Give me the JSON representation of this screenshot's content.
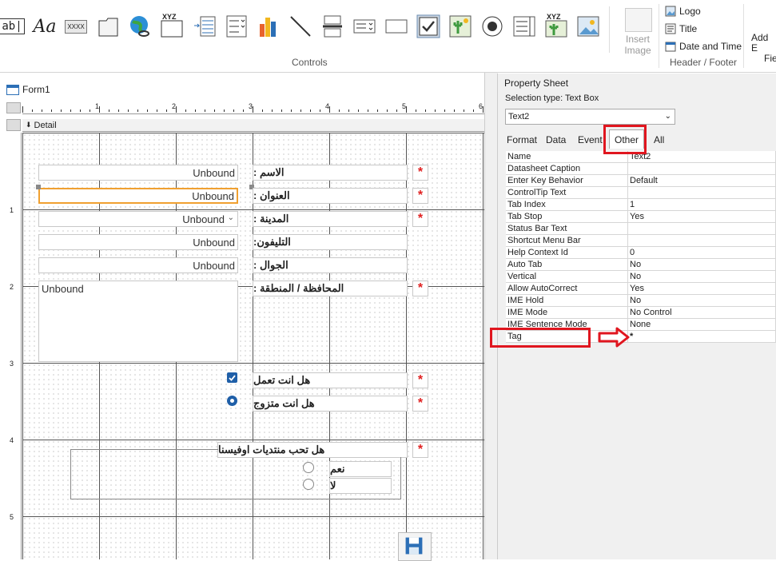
{
  "ribbon": {
    "controls_label": "Controls",
    "header_footer_label": "Header / Footer",
    "insert_image_label_1": "Insert",
    "insert_image_label_2": "Image",
    "textbox_icon_text": "ab|",
    "label_icon_text": "Aa",
    "button_icon_text": "XXXX",
    "xyz": "XYZ",
    "hf_items": [
      "Logo",
      "Title",
      "Date and Time"
    ],
    "add_fields_1": "Add E",
    "add_fields_2": "Fie"
  },
  "form": {
    "tab_title": "Form1",
    "section_title": "Detail",
    "ruler_numbers": [
      "1",
      "2",
      "3",
      "4",
      "5",
      "6"
    ],
    "vruler_numbers": [
      "1",
      "2",
      "3",
      "4",
      "5"
    ],
    "unbound": [
      "Unbound",
      "Unbound",
      "Unbound",
      "Unbound",
      "Unbound",
      "Unbound"
    ],
    "labels": {
      "name": "الاسم :",
      "address": "العنوان :",
      "city": "المدينة :",
      "phone": "التليفون:",
      "mobile": "الجوال :",
      "region": "المحافظة / المنطقة :",
      "work": "هل انت تعمل",
      "married": "هل انت متزوج",
      "forums": "هل تحب منتديات اوفيسنا",
      "yes": "نعم",
      "no": "لا"
    },
    "star": "*"
  },
  "property_sheet": {
    "title": "Property Sheet",
    "selection_type": "Selection type:  Text Box",
    "selected_control": "Text2",
    "tabs": [
      "Format",
      "Data",
      "Event",
      "Other",
      "All"
    ],
    "active_tab": "Other",
    "rows": [
      {
        "key": "Name",
        "value": "Text2"
      },
      {
        "key": "Datasheet Caption",
        "value": ""
      },
      {
        "key": "Enter Key Behavior",
        "value": "Default"
      },
      {
        "key": "ControlTip Text",
        "value": ""
      },
      {
        "key": "Tab Index",
        "value": "1"
      },
      {
        "key": "Tab Stop",
        "value": "Yes"
      },
      {
        "key": "Status Bar Text",
        "value": ""
      },
      {
        "key": "Shortcut Menu Bar",
        "value": ""
      },
      {
        "key": "Help Context Id",
        "value": "0"
      },
      {
        "key": "Auto Tab",
        "value": "No"
      },
      {
        "key": "Vertical",
        "value": "No"
      },
      {
        "key": "Allow AutoCorrect",
        "value": "Yes"
      },
      {
        "key": "IME Hold",
        "value": "No"
      },
      {
        "key": "IME Mode",
        "value": "No Control"
      },
      {
        "key": "IME Sentence Mode",
        "value": "None"
      },
      {
        "key": "Tag",
        "value": "*"
      }
    ]
  },
  "colors": {
    "annotation_red": "#e0161f",
    "selection_orange": "#f0a030",
    "checkbox_blue": "#1f5fa8",
    "required_star": "#e02020"
  }
}
